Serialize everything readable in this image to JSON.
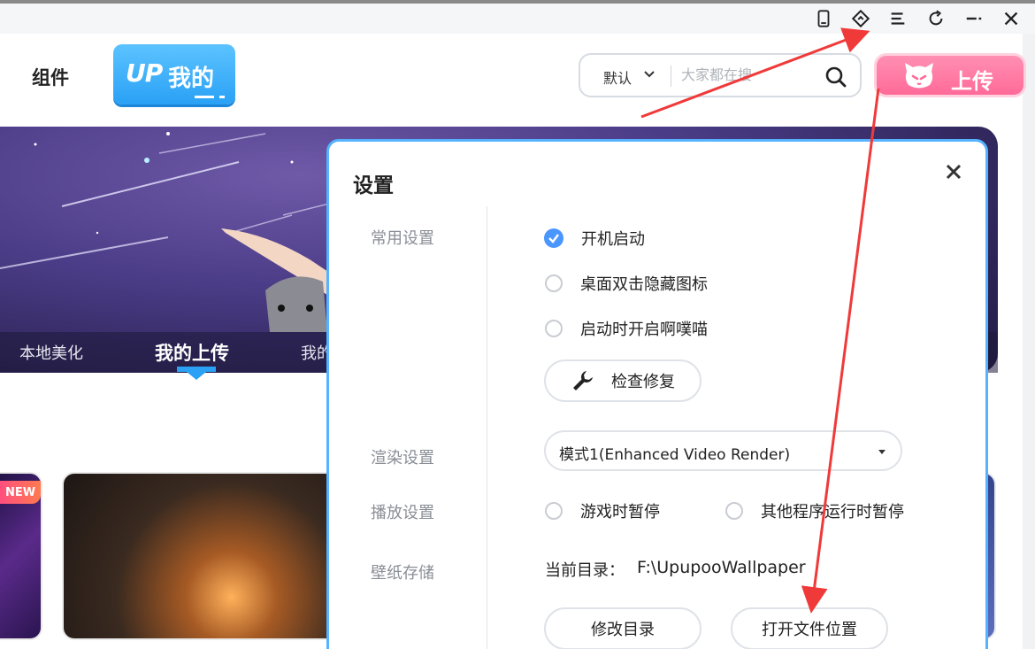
{
  "window_controls": {
    "icons": [
      "phone-icon",
      "diamond-icon",
      "menu-icon",
      "refresh-icon",
      "minimize-icon",
      "close-icon"
    ]
  },
  "header": {
    "nav_component": "组件",
    "mine_logo": "UP",
    "mine_button": "我的",
    "search": {
      "scope": "默认",
      "placeholder": "大家都在搜"
    },
    "upload_button": "上传"
  },
  "banner": {
    "tabs": [
      {
        "label": "本地美化"
      },
      {
        "label": "我的上传",
        "active": true
      },
      {
        "label": "我的"
      }
    ]
  },
  "cards": {
    "new_badge": "NEW"
  },
  "settings": {
    "title": "设置",
    "sections": {
      "general": "常用设置",
      "render": "渲染设置",
      "playback": "播放设置",
      "storage": "壁纸存储"
    },
    "general_options": [
      {
        "label": "开机启动",
        "checked": true
      },
      {
        "label": "桌面双击隐藏图标",
        "checked": false
      },
      {
        "label": "启动时开启啊噗喵",
        "checked": false
      }
    ],
    "repair_button": "检查修复",
    "render_mode": "模式1(Enhanced Video Render)",
    "playback_options": [
      {
        "label": "游戏时暂停",
        "checked": false
      },
      {
        "label": "其他程序运行时暂停",
        "checked": false
      }
    ],
    "current_dir_label": "当前目录：",
    "current_dir_value": "F:\\UpupooWallpaper",
    "change_dir_button": "修改目录",
    "open_location_button": "打开文件位置"
  },
  "colors": {
    "accent_blue": "#2aa1f5",
    "upload_pink": "#ff6a99",
    "check_blue": "#4a96ff",
    "annotation_red": "#f03a3a"
  }
}
